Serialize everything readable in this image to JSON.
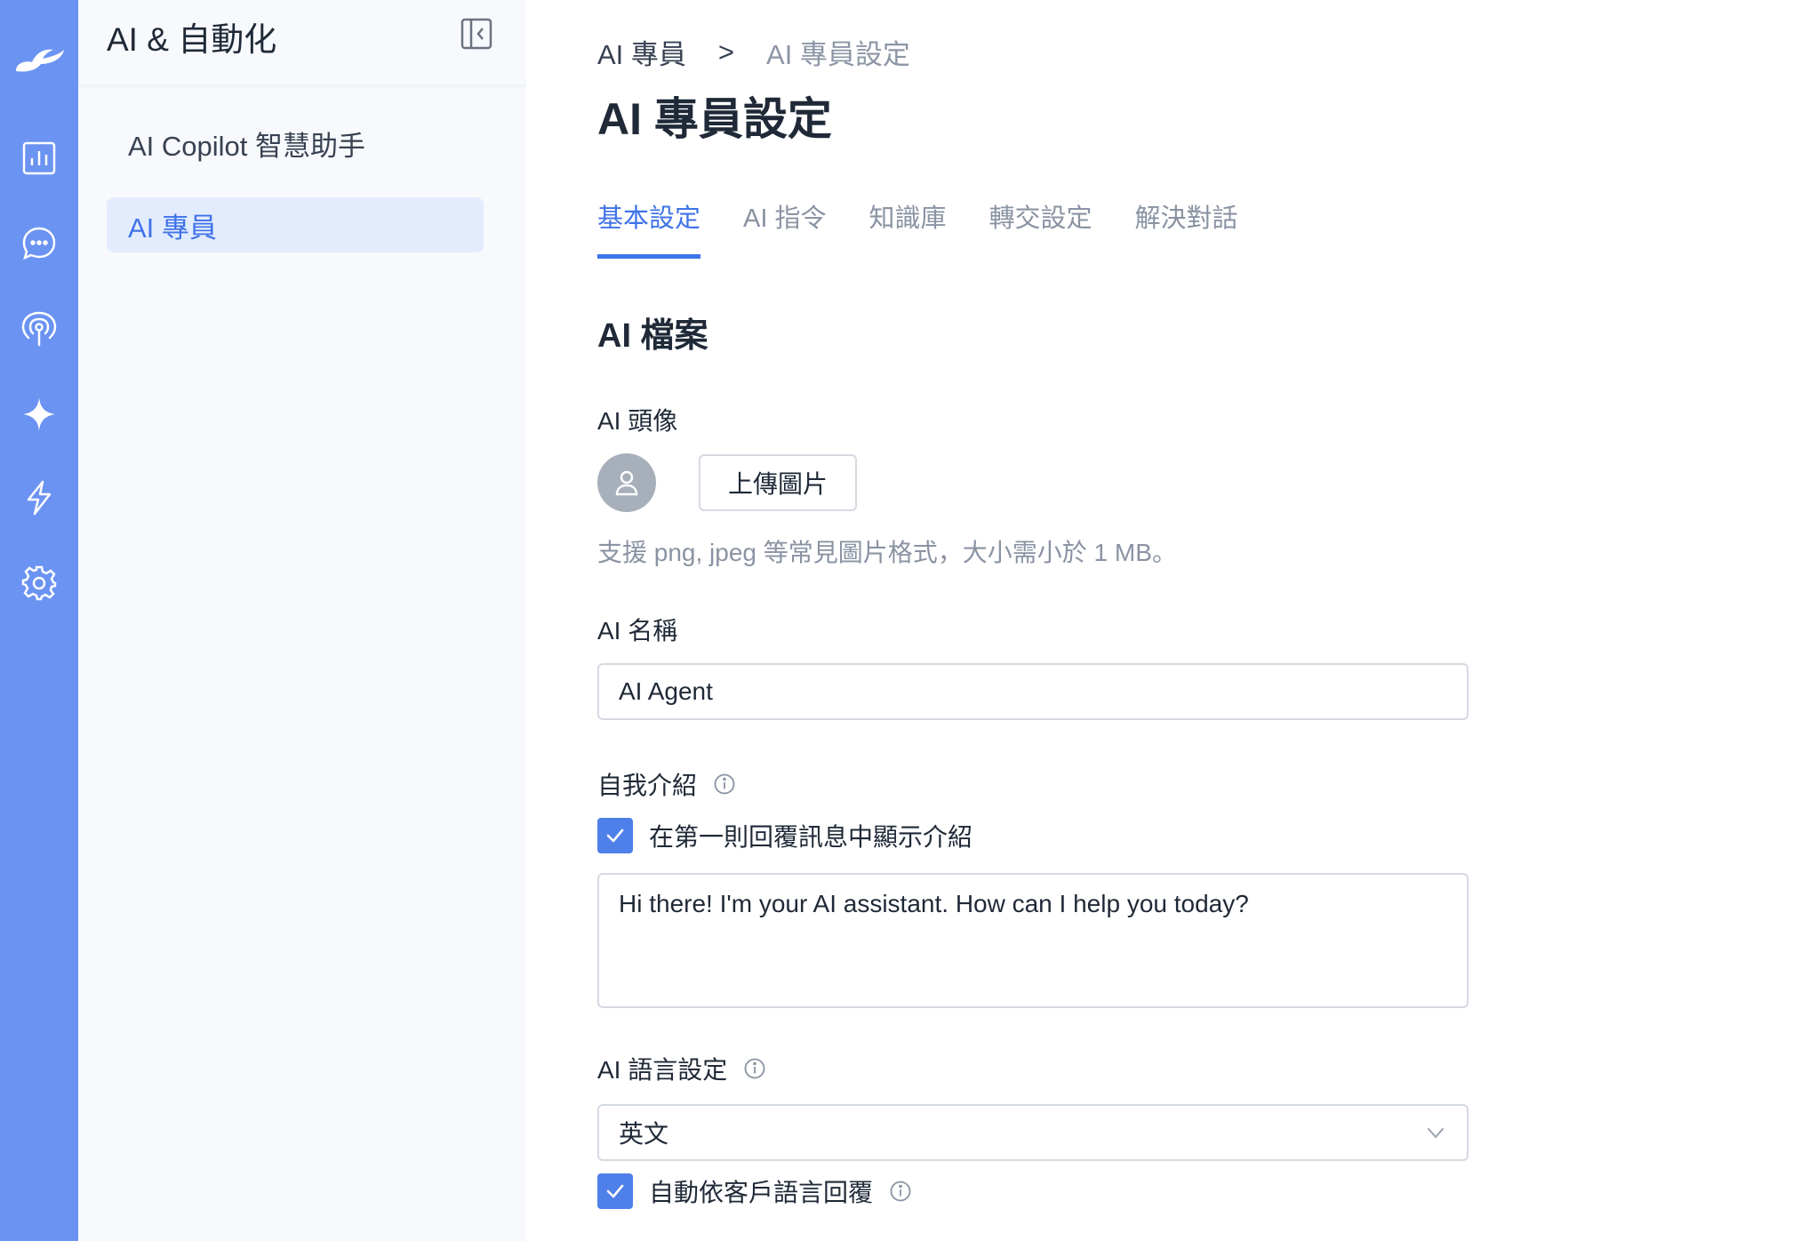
{
  "rail": {
    "bg_color": "#6b93f2",
    "icons": [
      "brand-logo",
      "analytics-icon",
      "chat-icon",
      "broadcast-icon",
      "ai-sparkle-icon",
      "automation-icon",
      "settings-icon"
    ]
  },
  "sidebar": {
    "title": "AI & 自動化",
    "collapse_icon": "sidebar-collapse-icon",
    "items": [
      {
        "label": "AI Copilot 智慧助手",
        "active": false
      },
      {
        "label": "AI 專員",
        "active": true
      }
    ]
  },
  "breadcrumb": {
    "parent": "AI 專員",
    "separator": ">",
    "current": "AI 專員設定"
  },
  "page_title": "AI 專員設定",
  "tabs": [
    {
      "label": "基本設定",
      "active": true
    },
    {
      "label": "AI 指令",
      "active": false
    },
    {
      "label": "知識庫",
      "active": false
    },
    {
      "label": "轉交設定",
      "active": false
    },
    {
      "label": "解決對話",
      "active": false
    }
  ],
  "profile": {
    "section_title": "AI 檔案",
    "avatar": {
      "label": "AI 頭像",
      "upload_button": "上傳圖片",
      "hint": "支援 png, jpeg 等常見圖片格式，大小需小於 1 MB。"
    },
    "name": {
      "label": "AI 名稱",
      "value": "AI Agent"
    },
    "intro": {
      "label": "自我介紹",
      "checkbox_label": "在第一則回覆訊息中顯示介紹",
      "checked": true,
      "value": "Hi there! I'm your AI assistant. How can I help you today?"
    },
    "language": {
      "label": "AI 語言設定",
      "selected": "英文",
      "auto_checkbox_label": "自動依客戶語言回覆",
      "auto_checked": true
    }
  },
  "colors": {
    "accent": "#3f73e8",
    "checkbox": "#4f7fe8",
    "active_item_bg": "#e3ecfd",
    "muted_text": "#8a93a3"
  }
}
